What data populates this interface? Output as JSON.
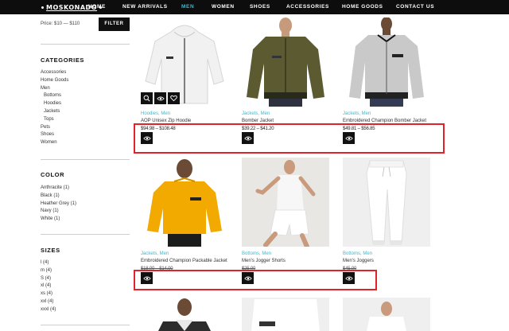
{
  "brand": {
    "logo_text": "MOSKONADO"
  },
  "nav": {
    "items": [
      {
        "label": "HOME",
        "active": false
      },
      {
        "label": "NEW ARRIVALS",
        "active": false
      },
      {
        "label": "MEN",
        "active": true
      },
      {
        "label": "WOMEN",
        "active": false
      },
      {
        "label": "SHOES",
        "active": false
      },
      {
        "label": "ACCESSORIES",
        "active": false
      },
      {
        "label": "HOME GOODS",
        "active": false
      },
      {
        "label": "CONTACT US",
        "active": false
      }
    ]
  },
  "filters": {
    "price_label": "Price: $10 — $110",
    "filter_button": "FILTER",
    "categories_title": "CATEGORIES",
    "categories": [
      {
        "label": "Accessories",
        "sub": false
      },
      {
        "label": "Home Goods",
        "sub": false
      },
      {
        "label": "Men",
        "sub": false
      },
      {
        "label": "Bottoms",
        "sub": true
      },
      {
        "label": "Hoodies",
        "sub": true
      },
      {
        "label": "Jackets",
        "sub": true
      },
      {
        "label": "Tops",
        "sub": true
      },
      {
        "label": "Pets",
        "sub": false
      },
      {
        "label": "Shoes",
        "sub": false
      },
      {
        "label": "Women",
        "sub": false
      }
    ],
    "color_title": "COLOR",
    "colors": [
      "Anthracite (1)",
      "Black (1)",
      "Heather Grey (1)",
      "Navy (1)",
      "White (1)"
    ],
    "sizes_title": "SIZES",
    "sizes": [
      "l (4)",
      "m (4)",
      "S (4)",
      "xl (4)",
      "xs (4)",
      "xxl (4)",
      "xxxl (4)"
    ]
  },
  "products": [
    {
      "category": "Hoodies, Men",
      "name": "AOP Unisex Zip Hoodie",
      "price": "$94.98 – $108.48",
      "strike": false,
      "colors": {
        "bg": "#ffffff",
        "item": "#f1f1f1"
      }
    },
    {
      "category": "Jackets, Men",
      "name": "Bomber Jacket",
      "price": "$39.22 – $41.20",
      "strike": false,
      "colors": {
        "bg": "#ffffff",
        "item": "#5c5a31"
      }
    },
    {
      "category": "Jackets, Men",
      "name": "Embroidered Champion Bomber Jacket",
      "price": "$49.81 – $56.85",
      "strike": false,
      "colors": {
        "bg": "#ffffff",
        "item": "#c9c9c9"
      }
    },
    {
      "category": "Jackets, Men",
      "name": "Embroidered Champion Packable Jacket",
      "price": "$18.00 – $14.00",
      "strike": true,
      "colors": {
        "bg": "#ffffff",
        "item": "#f2a900"
      }
    },
    {
      "category": "Bottoms, Men",
      "name": "Men's Jogger Shorts",
      "price": "$25.00",
      "strike": true,
      "colors": {
        "bg": "#e9e7e4",
        "item": "#f7f7f7"
      }
    },
    {
      "category": "Bottoms, Men",
      "name": "Men's Joggers",
      "price": "$45.00",
      "strike": true,
      "colors": {
        "bg": "#efefef",
        "item": "#ffffff"
      }
    }
  ],
  "colors": {
    "accent": "#3fb8c9",
    "nav_bg": "#0d0d0d",
    "highlight": "#e0222b"
  },
  "icons": [
    "search-icon",
    "eye-icon",
    "heart-icon"
  ]
}
